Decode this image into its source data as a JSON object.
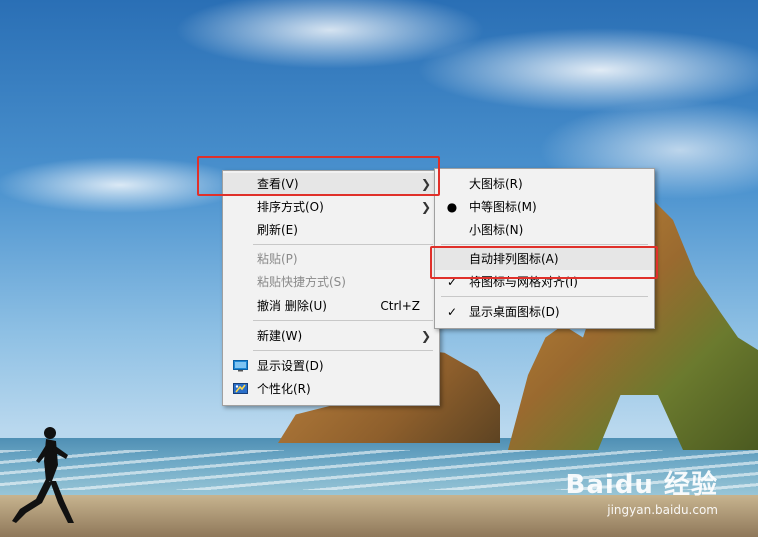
{
  "context_menu": {
    "items": [
      {
        "label": "查看(V)",
        "has_submenu": true
      },
      {
        "label": "排序方式(O)",
        "has_submenu": true
      },
      {
        "label": "刷新(E)"
      },
      {
        "label": "粘贴(P)",
        "disabled": true
      },
      {
        "label": "粘贴快捷方式(S)",
        "disabled": true
      },
      {
        "label": "撤消 删除(U)",
        "shortcut": "Ctrl+Z"
      },
      {
        "label": "新建(W)",
        "has_submenu": true
      },
      {
        "label": "显示设置(D)",
        "icon": "display-settings-icon"
      },
      {
        "label": "个性化(R)",
        "icon": "personalize-icon"
      }
    ]
  },
  "view_submenu": {
    "items": [
      {
        "label": "大图标(R)"
      },
      {
        "label": "中等图标(M)",
        "selected": true
      },
      {
        "label": "小图标(N)"
      },
      {
        "label": "自动排列图标(A)",
        "checked": false
      },
      {
        "label": "将图标与网格对齐(I)",
        "checked": true
      },
      {
        "label": "显示桌面图标(D)",
        "checked": true
      }
    ]
  },
  "watermark": {
    "logo": "Baidu 经验",
    "url": "jingyan.baidu.com"
  },
  "colors": {
    "highlight_box": "#e0302a",
    "menu_bg": "#f2f2f2"
  }
}
